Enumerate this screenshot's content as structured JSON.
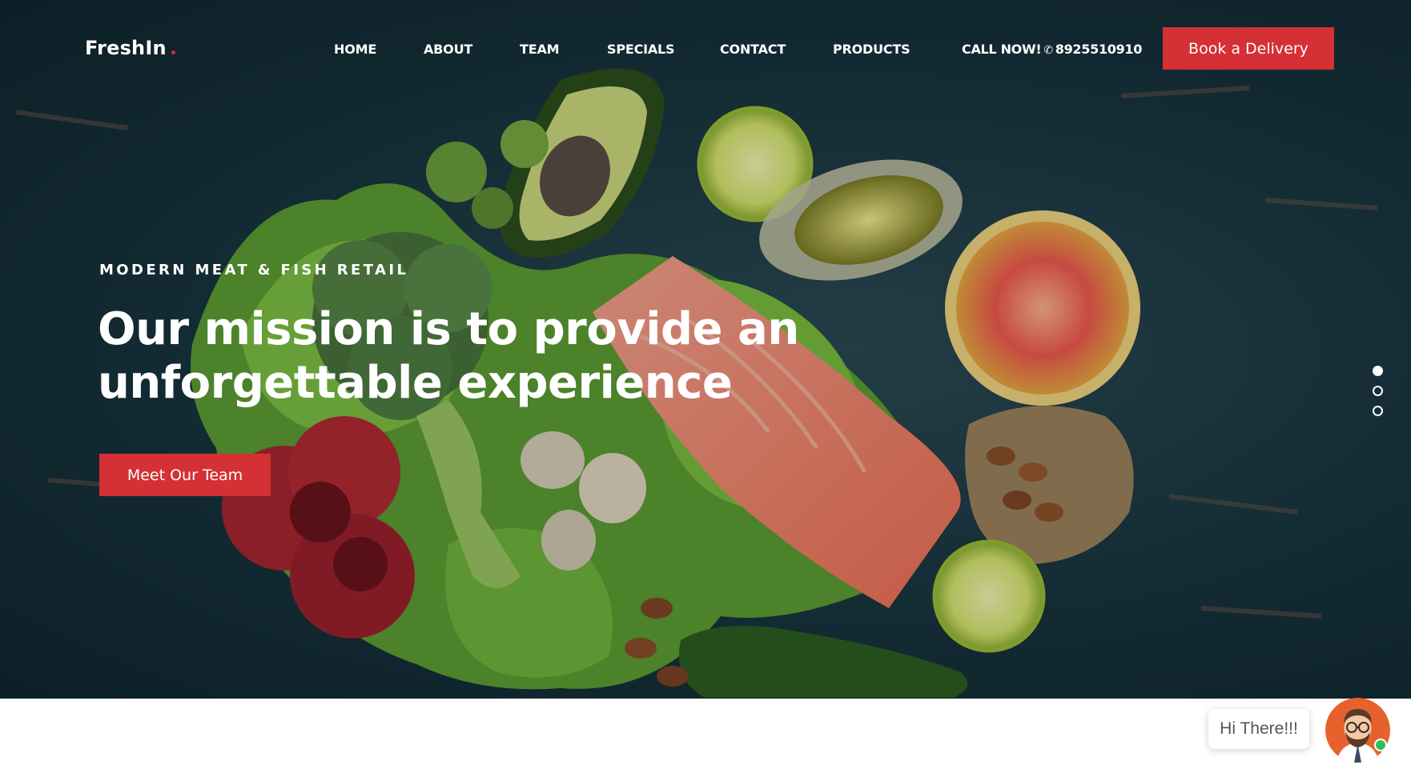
{
  "brand": {
    "name": "FreshIn"
  },
  "nav": {
    "items": [
      "HOME",
      "ABOUT",
      "TEAM",
      "SPECIALS",
      "CONTACT",
      "PRODUCTS"
    ],
    "call_label": "CALL NOW!",
    "phone": "8925510910",
    "cta": "Book a Delivery"
  },
  "hero": {
    "kicker": "MODERN MEAT & FISH RETAIL",
    "headline_line1": "Our mission is to provide an",
    "headline_line2": "unforgettable experience",
    "cta": "Meet Our Team",
    "slides": 3,
    "active_slide": 1
  },
  "chat": {
    "greeting": "Hi There!!!"
  },
  "colors": {
    "accent": "#d43035",
    "online": "#2fbf57",
    "hero_bg": "#173039"
  },
  "icons": [
    "phone-icon",
    "chat-avatar-icon",
    "online-status-icon"
  ]
}
